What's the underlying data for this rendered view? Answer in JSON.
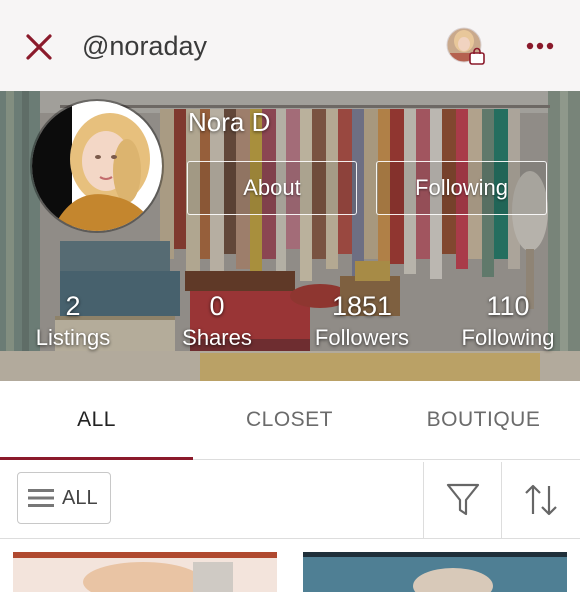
{
  "header": {
    "handle": "@noraday",
    "close_icon": "close-icon",
    "more_icon": "more-horizontal-icon",
    "bag_icon": "shopping-bag-icon",
    "accent_color": "#8b1a2b"
  },
  "profile": {
    "name": "Nora D",
    "about_label": "About",
    "following_label": "Following"
  },
  "stats": [
    {
      "value": "2",
      "label": "Listings"
    },
    {
      "value": "0",
      "label": "Shares"
    },
    {
      "value": "1851",
      "label": "Followers"
    },
    {
      "value": "110",
      "label": "Following"
    }
  ],
  "tabs": [
    {
      "label": "ALL",
      "active": true
    },
    {
      "label": "CLOSET",
      "active": false
    },
    {
      "label": "BOUTIQUE",
      "active": false
    }
  ],
  "filter_bar": {
    "all_label": "ALL",
    "menu_icon": "hamburger-menu-icon",
    "filter_icon": "filter-funnel-icon",
    "sort_icon": "sort-arrows-icon"
  }
}
